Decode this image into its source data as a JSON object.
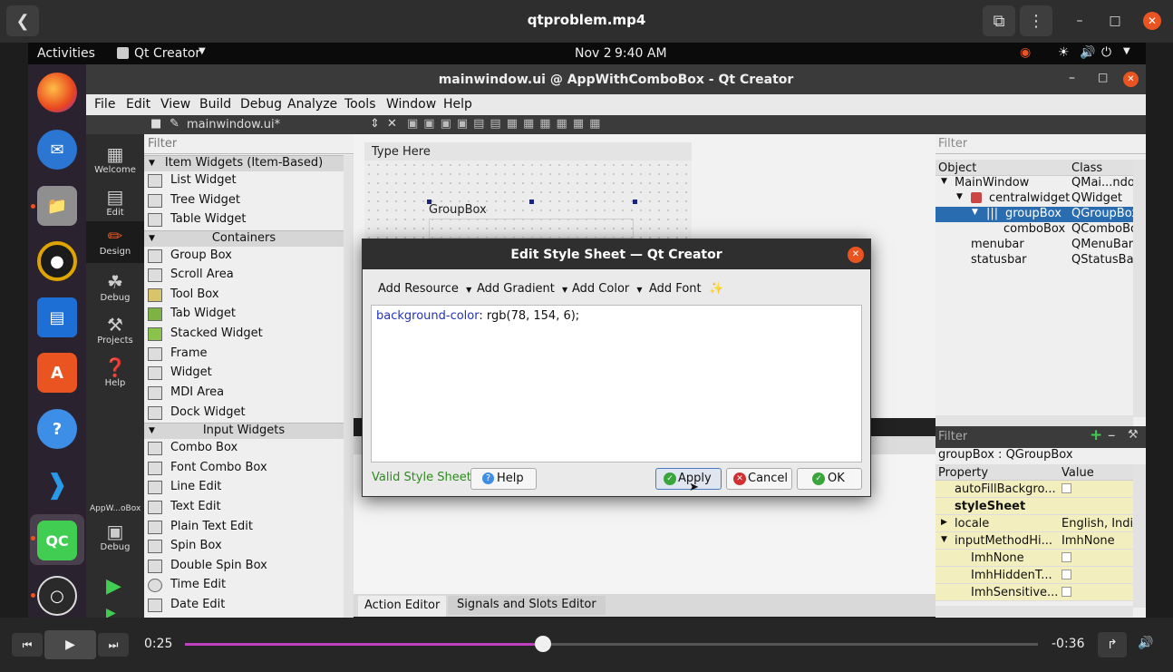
{
  "player": {
    "title": "qtproblem.mp4",
    "elapsed": "0:25",
    "remaining": "-0:36",
    "progress": 0.42
  },
  "topbar": {
    "activities": "Activities",
    "app": "Qt Creator",
    "date": "Nov 2",
    "time": "9:40 AM"
  },
  "qt": {
    "title": "mainwindow.ui @ AppWithComboBox - Qt Creator",
    "menu": [
      "File",
      "Edit",
      "View",
      "Build",
      "Debug",
      "Analyze",
      "Tools",
      "Window",
      "Help"
    ],
    "tab": "mainwindow.ui*",
    "modes": [
      "Welcome",
      "Edit",
      "Design",
      "Debug",
      "Projects",
      "Help"
    ],
    "project": "AppW...oBox",
    "debug2": "Debug",
    "filter": "Filter",
    "form_typehere": "Type Here",
    "groupbox_label": "GroupBox",
    "bottom_tabs": [
      "Action Editor",
      "Signals and Slots Editor"
    ]
  },
  "widgetbox": {
    "cat_items": "Item Widgets (Item-Based)",
    "items": [
      "List Widget",
      "Tree Widget",
      "Table Widget"
    ],
    "cat_containers": "Containers",
    "containers": [
      "Group Box",
      "Scroll Area",
      "Tool Box",
      "Tab Widget",
      "Stacked Widget",
      "Frame",
      "Widget",
      "MDI Area",
      "Dock Widget"
    ],
    "cat_input": "Input Widgets",
    "inputs": [
      "Combo Box",
      "Font Combo Box",
      "Line Edit",
      "Text Edit",
      "Plain Text Edit",
      "Spin Box",
      "Double Spin Box",
      "Time Edit",
      "Date Edit"
    ]
  },
  "objects": {
    "filter": "Filter",
    "col_object": "Object",
    "col_class": "Class",
    "rows": [
      {
        "name": "MainWindow",
        "cls": "QMai...ndo"
      },
      {
        "name": "centralwidget",
        "cls": "QWidget"
      },
      {
        "name": "groupBox",
        "cls": "QGroupBox"
      },
      {
        "name": "comboBox",
        "cls": "QComboBo"
      },
      {
        "name": "menubar",
        "cls": "QMenuBar"
      },
      {
        "name": "statusbar",
        "cls": "QStatusBar"
      }
    ]
  },
  "props": {
    "filter": "Filter",
    "header": "groupBox : QGroupBox",
    "col_property": "Property",
    "col_value": "Value",
    "rows": [
      {
        "name": "autoFillBackgro...",
        "val": ""
      },
      {
        "name": "styleSheet",
        "val": ""
      },
      {
        "name": "locale",
        "val": "English, India"
      },
      {
        "name": "inputMethodHi...",
        "val": "ImhNone"
      },
      {
        "name": "ImhNone",
        "val": ""
      },
      {
        "name": "ImhHiddenT...",
        "val": ""
      },
      {
        "name": "ImhSensitive...",
        "val": ""
      }
    ]
  },
  "dialog": {
    "title": "Edit Style Sheet — Qt Creator",
    "add_resource": "Add Resource",
    "add_gradient": "Add Gradient",
    "add_color": "Add Color",
    "add_font": "Add Font",
    "css_prop": "background-color",
    "css_value": ": rgb(78, 154, 6);",
    "status": "Valid Style Sheet",
    "help": "Help",
    "apply": "Apply",
    "cancel": "Cancel",
    "ok": "OK"
  },
  "colors": {
    "accent": "#e95420",
    "selection": "#2a6cb0",
    "valid": "#2e8b1e"
  }
}
